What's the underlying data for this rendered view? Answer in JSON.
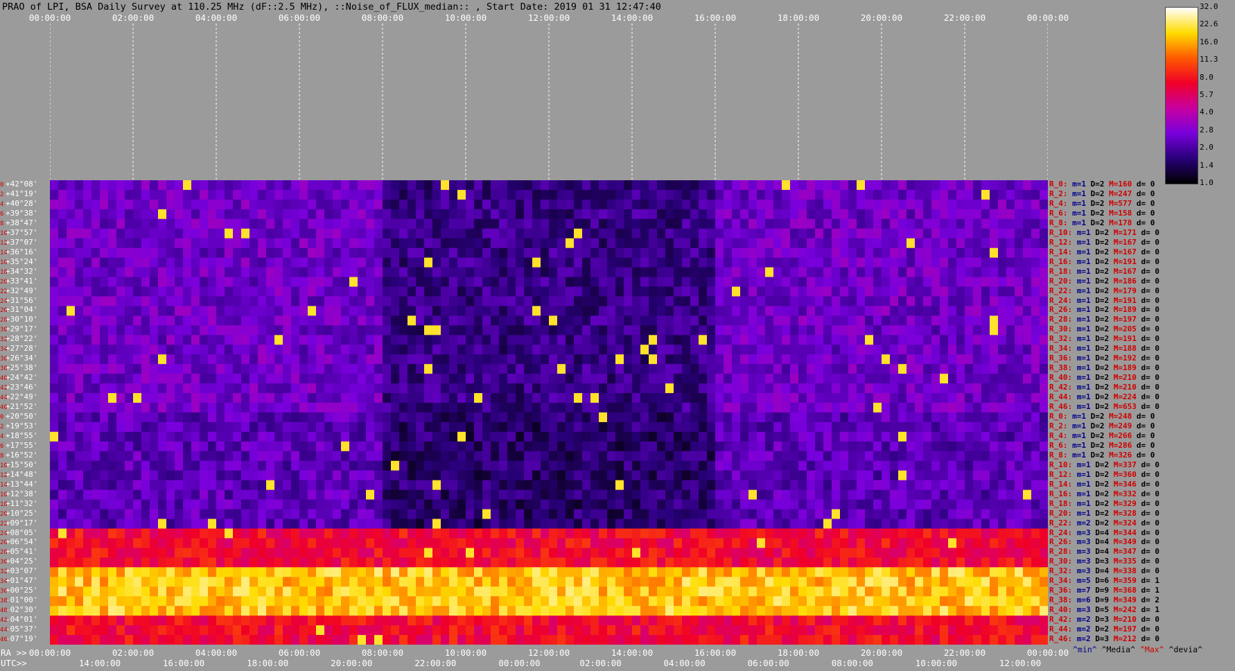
{
  "title": "PRAO of LPI, BSA Daily Survey at 110.25 MHz (dF::2.5 MHz), ::Noise_of_FLUX_median:: , Start Date: 2019 01 31 12:47:40",
  "colors": {
    "background": "#9b9b9b",
    "row_index": "#d00000",
    "label": "#ffffff",
    "min": "#00008b",
    "max": "#d00000"
  },
  "chart_data": {
    "type": "heatmap",
    "title": "PRAO of LPI, BSA Daily Survey at 110.25 MHz (dF::2.5 MHz), ::Noise_of_FLUX_median:: , Start Date: 2019 01 31 12:47:40",
    "xlabel": "RA >>",
    "x2label": "UTC>>",
    "x_ticks_ra": [
      "00:00:00",
      "02:00:00",
      "04:00:00",
      "06:00:00",
      "08:00:00",
      "10:00:00",
      "12:00:00",
      "14:00:00",
      "16:00:00",
      "18:00:00",
      "20:00:00",
      "22:00:00",
      "00:00:00"
    ],
    "x_ticks_utc": [
      "14:00:00",
      "16:00:00",
      "18:00:00",
      "20:00:00",
      "22:00:00",
      "00:00:00",
      "02:00:00",
      "04:00:00",
      "06:00:00",
      "08:00:00",
      "10:00:00",
      "12:00:00"
    ],
    "colorbar_ticks": [
      "32.0",
      "22.6",
      "16.0",
      "11.3",
      "8.0",
      "5.7",
      "4.0",
      "2.8",
      "2.0",
      "1.4",
      "1.0"
    ],
    "colorbar_range": [
      1.0,
      32.0
    ],
    "rows": [
      {
        "idx": "0",
        "dec": "+42°08'",
        "beam": "R_0:",
        "m": "m=1",
        "D": "D=2",
        "M": "M=160",
        "d": "d= 0"
      },
      {
        "idx": "2",
        "dec": "+41°19'",
        "beam": "R_2:",
        "m": "m=1",
        "D": "D=2",
        "M": "M=247",
        "d": "d= 0"
      },
      {
        "idx": "4",
        "dec": "+40°28'",
        "beam": "R_4:",
        "m": "m=1",
        "D": "D=2",
        "M": "M=577",
        "d": "d= 0"
      },
      {
        "idx": "6",
        "dec": "+39°38'",
        "beam": "R_6:",
        "m": "m=1",
        "D": "D=2",
        "M": "M=158",
        "d": "d= 0"
      },
      {
        "idx": "8",
        "dec": "+38°47'",
        "beam": "R_8:",
        "m": "m=1",
        "D": "D=2",
        "M": "M=178",
        "d": "d= 0"
      },
      {
        "idx": "10",
        "dec": "+37°57'",
        "beam": "R_10:",
        "m": "m=1",
        "D": "D=2",
        "M": "M=171",
        "d": "d= 0"
      },
      {
        "idx": "12",
        "dec": "+37°07'",
        "beam": "R_12:",
        "m": "m=1",
        "D": "D=2",
        "M": "M=167",
        "d": "d= 0"
      },
      {
        "idx": "14",
        "dec": "+36°16'",
        "beam": "R_14:",
        "m": "m=1",
        "D": "D=2",
        "M": "M=167",
        "d": "d= 0"
      },
      {
        "idx": "16",
        "dec": "+35°24'",
        "beam": "R_16:",
        "m": "m=1",
        "D": "D=2",
        "M": "M=191",
        "d": "d= 0"
      },
      {
        "idx": "18",
        "dec": "+34°32'",
        "beam": "R_18:",
        "m": "m=1",
        "D": "D=2",
        "M": "M=167",
        "d": "d= 0"
      },
      {
        "idx": "20",
        "dec": "+33°41'",
        "beam": "R_20:",
        "m": "m=1",
        "D": "D=2",
        "M": "M=186",
        "d": "d= 0"
      },
      {
        "idx": "22",
        "dec": "+32°49'",
        "beam": "R_22:",
        "m": "m=1",
        "D": "D=2",
        "M": "M=179",
        "d": "d= 0"
      },
      {
        "idx": "24",
        "dec": "+31°56'",
        "beam": "R_24:",
        "m": "m=1",
        "D": "D=2",
        "M": "M=191",
        "d": "d= 0"
      },
      {
        "idx": "26",
        "dec": "+31°04'",
        "beam": "R_26:",
        "m": "m=1",
        "D": "D=2",
        "M": "M=189",
        "d": "d= 0"
      },
      {
        "idx": "28",
        "dec": "+30°10'",
        "beam": "R_28:",
        "m": "m=1",
        "D": "D=2",
        "M": "M=197",
        "d": "d= 0"
      },
      {
        "idx": "30",
        "dec": "+29°17'",
        "beam": "R_30:",
        "m": "m=1",
        "D": "D=2",
        "M": "M=205",
        "d": "d= 0"
      },
      {
        "idx": "32",
        "dec": "+28°22'",
        "beam": "R_32:",
        "m": "m=1",
        "D": "D=2",
        "M": "M=191",
        "d": "d= 0"
      },
      {
        "idx": "34",
        "dec": "+27°28'",
        "beam": "R_34:",
        "m": "m=1",
        "D": "D=2",
        "M": "M=188",
        "d": "d= 0"
      },
      {
        "idx": "36",
        "dec": "+26°34'",
        "beam": "R_36:",
        "m": "m=1",
        "D": "D=2",
        "M": "M=192",
        "d": "d= 0"
      },
      {
        "idx": "38",
        "dec": "+25°38'",
        "beam": "R_38:",
        "m": "m=1",
        "D": "D=2",
        "M": "M=189",
        "d": "d= 0"
      },
      {
        "idx": "40",
        "dec": "+24°42'",
        "beam": "R_40:",
        "m": "m=1",
        "D": "D=2",
        "M": "M=210",
        "d": "d= 0"
      },
      {
        "idx": "42",
        "dec": "+23°46'",
        "beam": "R_42:",
        "m": "m=1",
        "D": "D=2",
        "M": "M=210",
        "d": "d= 0"
      },
      {
        "idx": "44",
        "dec": "+22°49'",
        "beam": "R_44:",
        "m": "m=1",
        "D": "D=2",
        "M": "M=224",
        "d": "d= 0"
      },
      {
        "idx": "46",
        "dec": "+21°52'",
        "beam": "R_46:",
        "m": "m=1",
        "D": "D=2",
        "M": "M=653",
        "d": "d= 0"
      },
      {
        "idx": "0",
        "dec": "+20°50'",
        "beam": "R_0:",
        "m": "m=1",
        "D": "D=2",
        "M": "M=248",
        "d": "d= 0"
      },
      {
        "idx": "2",
        "dec": "+19°53'",
        "beam": "R_2:",
        "m": "m=1",
        "D": "D=2",
        "M": "M=249",
        "d": "d= 0"
      },
      {
        "idx": "4",
        "dec": "+18°55'",
        "beam": "R_4:",
        "m": "m=1",
        "D": "D=2",
        "M": "M=266",
        "d": "d= 0"
      },
      {
        "idx": "6",
        "dec": "+17°55'",
        "beam": "R_6:",
        "m": "m=1",
        "D": "D=2",
        "M": "M=286",
        "d": "d= 0"
      },
      {
        "idx": "8",
        "dec": "+16°52'",
        "beam": "R_8:",
        "m": "m=1",
        "D": "D=2",
        "M": "M=326",
        "d": "d= 0"
      },
      {
        "idx": "10",
        "dec": "+15°50'",
        "beam": "R_10:",
        "m": "m=1",
        "D": "D=2",
        "M": "M=337",
        "d": "d= 0"
      },
      {
        "idx": "12",
        "dec": "+14°48'",
        "beam": "R_12:",
        "m": "m=1",
        "D": "D=2",
        "M": "M=360",
        "d": "d= 0"
      },
      {
        "idx": "14",
        "dec": "+13°44'",
        "beam": "R_14:",
        "m": "m=1",
        "D": "D=2",
        "M": "M=346",
        "d": "d= 0"
      },
      {
        "idx": "16",
        "dec": "+12°38'",
        "beam": "R_16:",
        "m": "m=1",
        "D": "D=2",
        "M": "M=332",
        "d": "d= 0"
      },
      {
        "idx": "18",
        "dec": "+11°32'",
        "beam": "R_18:",
        "m": "m=1",
        "D": "D=2",
        "M": "M=329",
        "d": "d= 0"
      },
      {
        "idx": "20",
        "dec": "+10°25'",
        "beam": "R_20:",
        "m": "m=1",
        "D": "D=2",
        "M": "M=328",
        "d": "d= 0"
      },
      {
        "idx": "22",
        "dec": "+09°17'",
        "beam": "R_22:",
        "m": "m=2",
        "D": "D=2",
        "M": "M=324",
        "d": "d= 0"
      },
      {
        "idx": "24",
        "dec": "+08°05'",
        "beam": "R_24:",
        "m": "m=3",
        "D": "D=4",
        "M": "M=344",
        "d": "d= 0"
      },
      {
        "idx": "26",
        "dec": "+06°54'",
        "beam": "R_26:",
        "m": "m=3",
        "D": "D=4",
        "M": "M=349",
        "d": "d= 0"
      },
      {
        "idx": "28",
        "dec": "+05°41'",
        "beam": "R_28:",
        "m": "m=3",
        "D": "D=4",
        "M": "M=347",
        "d": "d= 0"
      },
      {
        "idx": "30",
        "dec": "+04°25'",
        "beam": "R_30:",
        "m": "m=3",
        "D": "D=3",
        "M": "M=335",
        "d": "d= 0"
      },
      {
        "idx": "32",
        "dec": "+03°07'",
        "beam": "R_32:",
        "m": "m=3",
        "D": "D=4",
        "M": "M=338",
        "d": "d= 0"
      },
      {
        "idx": "34",
        "dec": "+01°47'",
        "beam": "R_34:",
        "m": "m=5",
        "D": "D=6",
        "M": "M=359",
        "d": "d= 1"
      },
      {
        "idx": "36",
        "dec": "+00°25'",
        "beam": "R_36:",
        "m": "m=7",
        "D": "D=9",
        "M": "M=368",
        "d": "d= 1"
      },
      {
        "idx": "38",
        "dec": "-01°00'",
        "beam": "R_38:",
        "m": "m=6",
        "D": "D=9",
        "M": "M=349",
        "d": "d= 2"
      },
      {
        "idx": "40",
        "dec": "-02°30'",
        "beam": "R_40:",
        "m": "m=3",
        "D": "D=5",
        "M": "M=242",
        "d": "d= 1"
      },
      {
        "idx": "42",
        "dec": "-04°01'",
        "beam": "R_42:",
        "m": "m=2",
        "D": "D=3",
        "M": "M=210",
        "d": "d= 0"
      },
      {
        "idx": "44",
        "dec": "-05°37'",
        "beam": "R_44:",
        "m": "m=2",
        "D": "D=2",
        "M": "M=197",
        "d": "d= 0"
      },
      {
        "idx": "46",
        "dec": "-07°19'",
        "beam": "R_46:",
        "m": "m=2",
        "D": "D=3",
        "M": "M=212",
        "d": "d= 0"
      }
    ],
    "legend": [
      "^min^",
      "^Media^",
      "^Max^",
      "^devia^"
    ]
  }
}
